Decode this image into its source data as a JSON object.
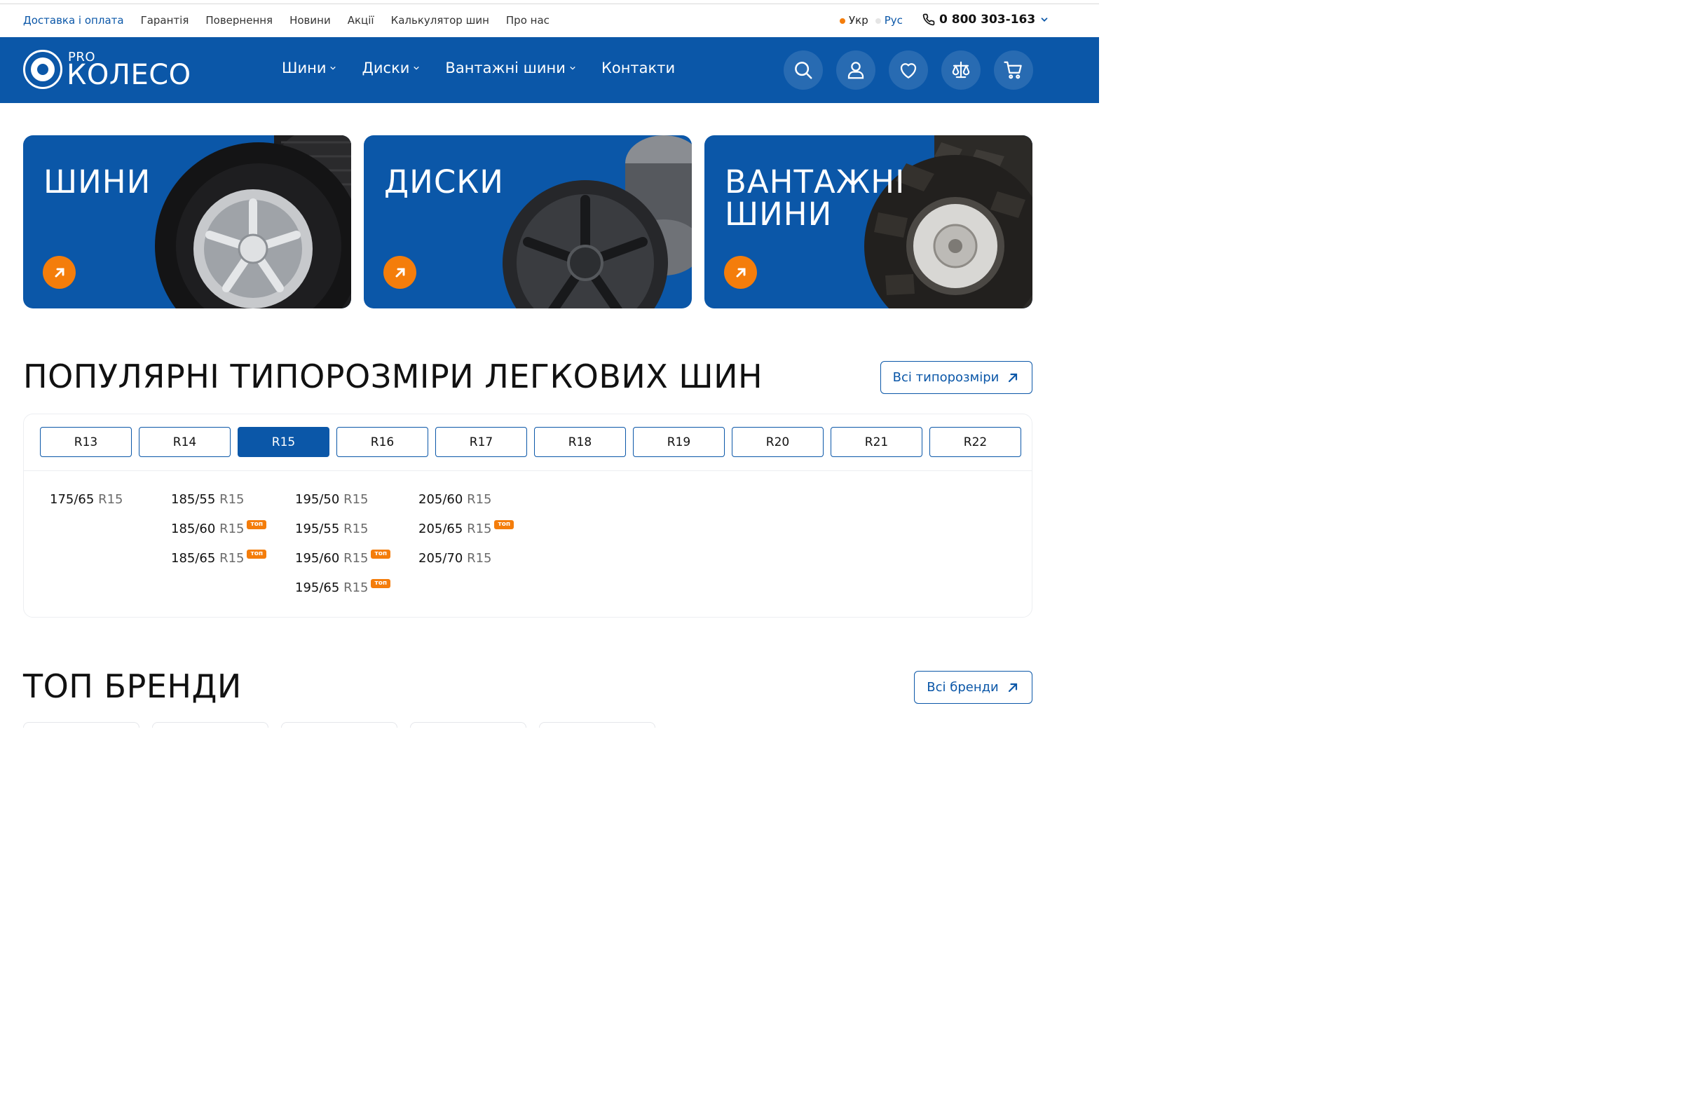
{
  "util_links": [
    "Доставка і оплата",
    "Гарантія",
    "Повернення",
    "Новини",
    "Акції",
    "Калькулятор шин",
    "Про нас"
  ],
  "util_active_index": 0,
  "languages": [
    {
      "label": "Укр",
      "dot_color": "#f47d0b",
      "active": true
    },
    {
      "label": "Рус",
      "dot_color": "#e5e5e5",
      "active": false
    }
  ],
  "phone": "0 800 303-163",
  "logo": {
    "pro": "PRO",
    "name": "КОЛЕСО"
  },
  "nav": [
    {
      "label": "Шини",
      "has_dropdown": true
    },
    {
      "label": "Диски",
      "has_dropdown": true
    },
    {
      "label": "Вантажні шини",
      "has_dropdown": true
    },
    {
      "label": "Контакти",
      "has_dropdown": false
    }
  ],
  "header_icons": [
    "search-icon",
    "user-icon",
    "heart-icon",
    "compare-scales-icon",
    "cart-icon"
  ],
  "categories": [
    {
      "title": "ШИНИ"
    },
    {
      "title": "ДИСКИ"
    },
    {
      "title": "ВАНТАЖНІ\nШИНИ"
    }
  ],
  "popular": {
    "title": "ПОПУЛЯРНІ ТИПОРОЗМІРИ ЛЕГКОВИХ ШИН",
    "all_button": "Всі типорозміри",
    "tabs": [
      "R13",
      "R14",
      "R15",
      "R16",
      "R17",
      "R18",
      "R19",
      "R20",
      "R21",
      "R22"
    ],
    "active_tab": 2,
    "badge_label": "топ",
    "columns": [
      [
        {
          "size": "175/65",
          "r": "R15",
          "top": false
        }
      ],
      [
        {
          "size": "185/55",
          "r": "R15",
          "top": false
        },
        {
          "size": "185/60",
          "r": "R15",
          "top": true
        },
        {
          "size": "185/65",
          "r": "R15",
          "top": true
        }
      ],
      [
        {
          "size": "195/50",
          "r": "R15",
          "top": false
        },
        {
          "size": "195/55",
          "r": "R15",
          "top": false
        },
        {
          "size": "195/60",
          "r": "R15",
          "top": true
        },
        {
          "size": "195/65",
          "r": "R15",
          "top": true
        }
      ],
      [
        {
          "size": "205/60",
          "r": "R15",
          "top": false
        },
        {
          "size": "205/65",
          "r": "R15",
          "top": true
        },
        {
          "size": "205/70",
          "r": "R15",
          "top": false
        }
      ]
    ]
  },
  "brands": {
    "title": "ТОП БРЕНДИ",
    "all_button": "Всі бренди"
  },
  "colors": {
    "brand_blue": "#0b57a8",
    "accent_orange": "#f47d0b"
  }
}
